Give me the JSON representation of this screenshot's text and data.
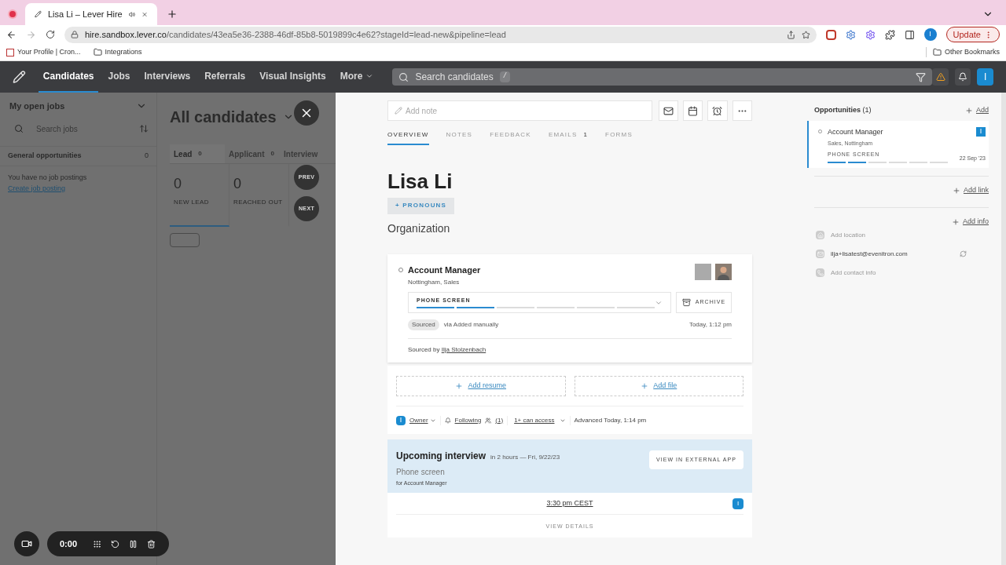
{
  "browser": {
    "tab_title": "Lisa Li –  Lever Hire",
    "url_host": "hire.sandbox.lever.co",
    "url_path": "/candidates/43ea5e36-2388-46df-85b8-5019899c4e62?stageId=lead-new&pipeline=lead",
    "profile_initial": "I",
    "update_label": "Update",
    "bookmarks": [
      {
        "kind": "site",
        "label": "Your Profile | Cron..."
      },
      {
        "kind": "folder",
        "label": "Integrations"
      }
    ],
    "other_bookmarks": "Other Bookmarks"
  },
  "nav": {
    "items": [
      {
        "label": "Candidates",
        "selected": true
      },
      {
        "label": "Jobs",
        "selected": false
      },
      {
        "label": "Interviews",
        "selected": false
      },
      {
        "label": "Referrals",
        "selected": false
      },
      {
        "label": "Visual Insights",
        "selected": false
      },
      {
        "label": "More",
        "selected": false
      }
    ],
    "search_placeholder": "Search candidates",
    "search_shortcut": "/",
    "user_initial": "I"
  },
  "sidebar": {
    "title": "My open jobs",
    "search_placeholder": "Search jobs",
    "group_label": "General opportunities",
    "group_count": "0",
    "empty_text": "You have no job postings",
    "create_link": "Create job posting"
  },
  "pipeline": {
    "title": "All candidates",
    "stages": [
      {
        "label": "Lead",
        "count": "0",
        "selected": true
      },
      {
        "label": "Applicant",
        "count": "0",
        "selected": false
      },
      {
        "label": "Interview",
        "selected": false
      }
    ],
    "substages": [
      {
        "count": "0",
        "label": "NEW LEAD",
        "selected": true
      },
      {
        "count": "0",
        "label": "REACHED OUT",
        "selected": false
      }
    ]
  },
  "drawer": {
    "prev_label": "PREV",
    "next_label": "NEXT",
    "note_placeholder": "Add note",
    "tabs": [
      {
        "label": "OVERVIEW",
        "selected": true
      },
      {
        "label": "NOTES",
        "selected": false
      },
      {
        "label": "FEEDBACK",
        "selected": false
      },
      {
        "label": "EMAILS",
        "count": "1",
        "selected": false
      },
      {
        "label": "FORMS",
        "selected": false
      }
    ],
    "name": "Lisa Li",
    "pronouns_button": "+ PRONOUNS",
    "organization": "Organization",
    "card": {
      "title": "Account Manager",
      "subtitle": "Nottingham, Sales",
      "stage": "PHONE SCREEN",
      "segments": [
        {
          "done": true
        },
        {
          "done": true
        },
        {
          "done": false
        },
        {
          "done": false
        },
        {
          "done": false
        },
        {
          "done": false
        }
      ],
      "archive": "ARCHIVE",
      "source_tag": "Sourced",
      "source_via": "via Added manually",
      "time": "Today, 1:12 pm",
      "sourced_by": "Sourced by",
      "sourced_by_name": "Ilja Stolzenbach"
    },
    "add_resume": "Add resume",
    "add_file": "Add file",
    "meta": {
      "owner_initial": "I",
      "owner": "Owner",
      "following": "Following",
      "followers": "(1)",
      "access": "1+ can access",
      "advanced": "Advanced Today, 1:14 pm"
    },
    "interview": {
      "title": "Upcoming interview",
      "when": "in 2 hours — Fri, 9/22/23",
      "type": "Phone screen",
      "for": "for Account Manager",
      "external_button": "VIEW IN EXTERNAL APP",
      "time": "3:30 pm CEST",
      "interviewer_initial": "I",
      "details": "VIEW DETAILS"
    }
  },
  "side": {
    "title": "Opportunities",
    "count": "(1)",
    "add": "Add",
    "opportunity": {
      "title": "Account Manager",
      "subtitle": "Sales, Nottingham",
      "stage": "PHONE SCREEN",
      "date": "22 Sep '23",
      "badge": "I",
      "segments": [
        {
          "done": true
        },
        {
          "done": true
        },
        {
          "done": false
        },
        {
          "done": false
        },
        {
          "done": false
        },
        {
          "done": false
        }
      ]
    },
    "add_link": "Add link",
    "add_info": "Add info",
    "contacts": [
      {
        "kind": "location",
        "text": "Add location",
        "empty": true
      },
      {
        "kind": "email",
        "text": "ilja+lisatest@evenitron.com",
        "empty": false
      },
      {
        "kind": "phone",
        "text": "Add contact info",
        "empty": true
      }
    ]
  },
  "recorder": {
    "time": "0:00"
  }
}
